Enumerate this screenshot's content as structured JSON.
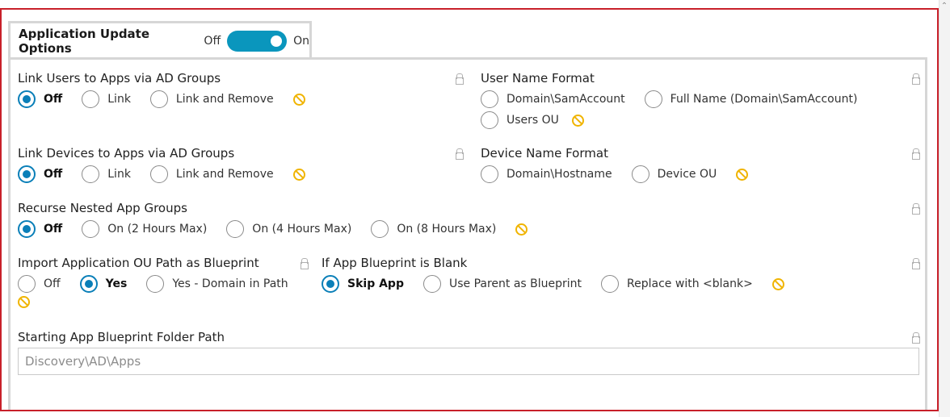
{
  "header": {
    "title": "Application Update Options",
    "toggle_off_label": "Off",
    "toggle_on_label": "On",
    "toggle_state": "On"
  },
  "link_users": {
    "label": "Link Users to Apps via AD Groups",
    "options": [
      "Off",
      "Link",
      "Link and Remove"
    ],
    "selected": "Off"
  },
  "user_name_format": {
    "label": "User Name Format",
    "options": [
      "Domain\\SamAccount",
      "Full Name (Domain\\SamAccount)",
      "Users OU"
    ],
    "selected": ""
  },
  "link_devices": {
    "label": "Link Devices to Apps via AD Groups",
    "options": [
      "Off",
      "Link",
      "Link and Remove"
    ],
    "selected": "Off"
  },
  "device_name_format": {
    "label": "Device Name Format",
    "options": [
      "Domain\\Hostname",
      "Device OU"
    ],
    "selected": ""
  },
  "recurse_nested": {
    "label": "Recurse Nested App Groups",
    "options": [
      "Off",
      "On (2 Hours Max)",
      "On (4 Hours Max)",
      "On (8 Hours Max)"
    ],
    "selected": "Off"
  },
  "import_ou_path": {
    "label": "Import Application OU Path as Blueprint",
    "options": [
      "Off",
      "Yes",
      "Yes - Domain in Path"
    ],
    "selected": "Yes"
  },
  "blank_blueprint": {
    "label": "If App Blueprint is Blank",
    "options": [
      "Skip App",
      "Use Parent as Blueprint",
      "Replace with <blank>"
    ],
    "selected": "Skip App"
  },
  "starting_folder": {
    "label": "Starting App Blueprint Folder Path",
    "value": "",
    "placeholder": "Discovery\\AD\\Apps"
  },
  "colors": {
    "accent": "#0a7fb8",
    "toggle": "#0a96bd",
    "frame_border": "#c8202a",
    "no_icon": "#f0b400"
  },
  "icons": {
    "reset": "no-entry-icon",
    "lock": "lock-icon",
    "scroll": "chevron-up-icon"
  }
}
